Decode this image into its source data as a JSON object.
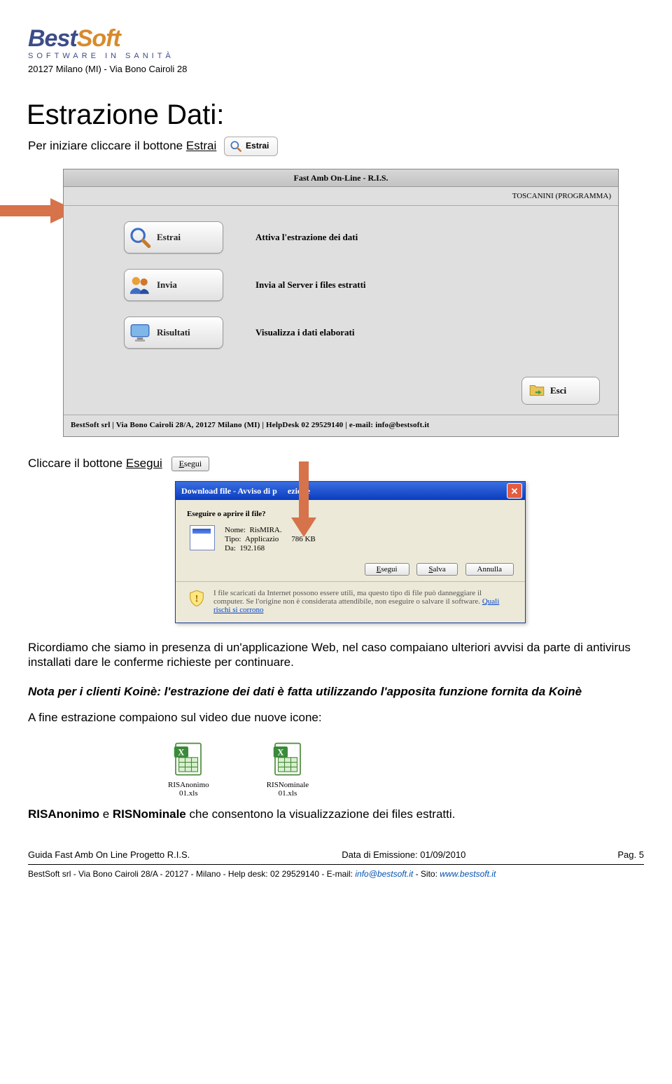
{
  "header": {
    "logo_a": "Best",
    "logo_b": "Soft",
    "tagline": "SOFTWARE IN SANITÀ",
    "address": "20127 Milano (MI) - Via Bono Cairoli 28"
  },
  "title": "Estrazione Dati:",
  "intro": {
    "pre": "Per iniziare cliccare il bottone ",
    "link": "Estrai",
    "btn_label": "Estrai"
  },
  "app": {
    "title": "Fast Amb On-Line - R.I.S.",
    "user": "TOSCANINI (PROGRAMMA)",
    "buttons": [
      {
        "label": "Estrai",
        "desc": "Attiva l'estrazione dei dati",
        "icon": "search"
      },
      {
        "label": "Invia",
        "desc": "Invia al Server i files estratti",
        "icon": "people"
      },
      {
        "label": "Risultati",
        "desc": "Visualizza i dati elaborati",
        "icon": "monitor"
      }
    ],
    "exit": "Esci",
    "footer": "BestSoft srl | Via Bono Cairoli 28/A, 20127 Milano (MI) | HelpDesk 02 29529140 | e-mail: info@bestsoft.it"
  },
  "secondline": {
    "pre": "Cliccare il bottone ",
    "link": "Esegui",
    "btn_label": "Esegui"
  },
  "dialog": {
    "title_a": "Download file - Avviso di p",
    "title_b": "ezione",
    "question": "Eseguire o aprire il file?",
    "kv": {
      "k1": "Nome:",
      "v1": "RisMIRA.",
      "k2": "Tipo:",
      "v2a": "Applicazio",
      "v2b": "786 KB",
      "k3": "Da:",
      "v3": "192.168"
    },
    "btn1": "Esegui",
    "btn2": "Salva",
    "btn3": "Annulla",
    "warn": "I file scaricati da Internet possono essere utili, ma questo tipo di file può danneggiare il computer. Se l'origine non è considerata attendibile, non eseguire o salvare il software. ",
    "warn_link": "Quali rischi si corrono"
  },
  "paragraph1": "Ricordiamo che siamo in presenza di un'applicazione Web, nel caso compaiano ulteriori avvisi da parte di antivirus installati dare le conferme richieste per continuare.",
  "note": "Nota per i clienti Koinè: l'estrazione dei dati è fatta utilizzando l'apposita funzione fornita da Koinè",
  "paragraph2": "A fine estrazione compaiono sul video due nuove icone:",
  "xls": [
    {
      "name1": "RISAnonimo",
      "name2": "01.xls"
    },
    {
      "name1": "RISNominale",
      "name2": "01.xls"
    }
  ],
  "closing": {
    "a": "RISAnonimo",
    "mid": " e ",
    "b": "RISNominale",
    "rest": " che consentono la visualizzazione dei files estratti."
  },
  "footer": {
    "left": "Guida Fast Amb On Line Progetto R.I.S.",
    "center": "Data di Emissione: 01/09/2010",
    "right": "Pag. 5",
    "line2_a": "BestSoft srl - Via Bono Cairoli 28/A - 20127 - Milano - Help desk: 02 29529140 - E-mail: ",
    "email": "info@bestsoft.it",
    "line2_b": " - Sito: ",
    "site": "www.bestsoft.it"
  }
}
